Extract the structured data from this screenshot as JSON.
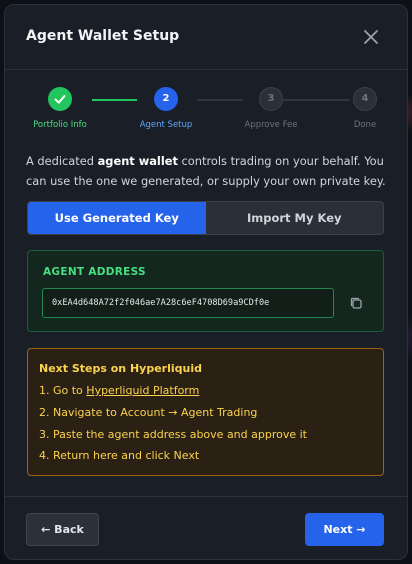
{
  "modal": {
    "title": "Agent Wallet Setup"
  },
  "stepper": {
    "steps": [
      {
        "number": "✓",
        "label": "Portfolio Info",
        "state": "done"
      },
      {
        "number": "2",
        "label": "Agent Setup",
        "state": "active"
      },
      {
        "number": "3",
        "label": "Approve Fee",
        "state": "todo"
      },
      {
        "number": "4",
        "label": "Done",
        "state": "todo"
      }
    ]
  },
  "description": {
    "prefix": "A dedicated ",
    "bold": "agent wallet",
    "suffix": " controls trading on your behalf. You can use the one we generated, or supply your own private key."
  },
  "tabs": {
    "generated": "Use Generated Key",
    "import": "Import My Key",
    "selected": "Use Generated Key"
  },
  "agent": {
    "label": "AGENT ADDRESS",
    "address": "0xEA4d648A72f2f046ae7A28c6eF4708D69a9CDf0e"
  },
  "next_steps": {
    "title": "Next Steps on Hyperliquid",
    "step1_prefix": "1. Go to ",
    "step1_link": "Hyperliquid Platform",
    "step2": "2. Navigate to Account → Agent Trading",
    "step3": "3. Paste the agent address above and approve it",
    "step4": "4. Return here and click Next"
  },
  "footer": {
    "back": "← Back",
    "next": "Next →"
  },
  "colors": {
    "accent": "#2563eb",
    "success": "#22c55e",
    "warning": "#fcd34d",
    "modal_bg": "#1a1f27"
  }
}
